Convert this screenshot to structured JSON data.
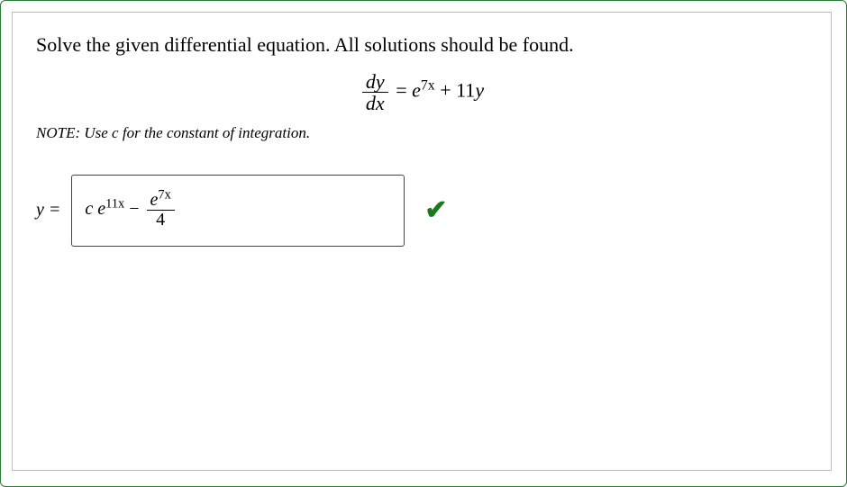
{
  "problem": {
    "prompt": "Solve the given differential equation. All solutions should be found.",
    "equation": {
      "lhs_num": "dy",
      "lhs_den": "dx",
      "equals": " = ",
      "rhs_term1_base": "e",
      "rhs_term1_exp": "7x",
      "rhs_plus": " + ",
      "rhs_term2_coef": "11",
      "rhs_term2_var": "y"
    },
    "note": "NOTE: Use c for the constant of integration."
  },
  "answer": {
    "lhs_var": "y",
    "equals": " = ",
    "term1_coef": "c ",
    "term1_base": "e",
    "term1_exp": "11x",
    "minus": " − ",
    "term2_num_base": "e",
    "term2_num_exp": "7x",
    "term2_den": "4"
  },
  "status": {
    "correct_mark": "✔"
  }
}
